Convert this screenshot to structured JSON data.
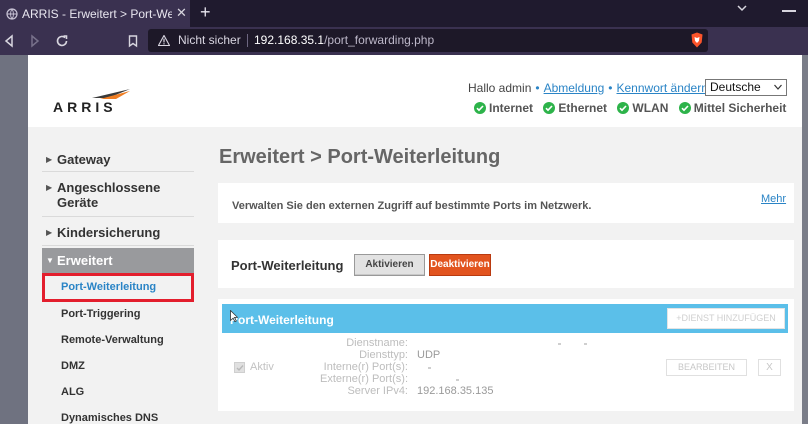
{
  "browser": {
    "tab_title": "ARRIS - Erweitert > Port-Weiterle",
    "new_tab_glyph": "+",
    "close_glyph": "✕",
    "security_label": "Nicht sicher",
    "url_host": "192.168.35.1",
    "url_path": "/port_forwarding.php",
    "icons": [
      "back-icon",
      "forward-icon",
      "reload-icon",
      "bookmark-icon",
      "warning-icon",
      "brave-shield-icon"
    ]
  },
  "header": {
    "logo": "ARRIS",
    "greeting": "Hallo admin",
    "logout": "Abmeldung",
    "change_password": "Kennwort ändern",
    "language": "Deutsche",
    "status": [
      "Internet",
      "Ethernet",
      "WLAN",
      "Mittel Sicherheit"
    ],
    "status_color": "#2db34a"
  },
  "sidebar": {
    "items": [
      "Gateway",
      "Angeschlossene Geräte",
      "Kindersicherung",
      "Erweitert"
    ],
    "item_lines": {
      "angeschlossene_1": "Angeschlossene",
      "angeschlossene_2": "Geräte"
    },
    "submenu": [
      "Port-Weiterleitung",
      "Port-Triggering",
      "Remote-Verwaltung",
      "DMZ",
      "ALG",
      "Dynamisches DNS"
    ]
  },
  "main": {
    "title": "Erweitert > Port-Weiterleitung",
    "info": "Verwalten Sie den externen Zugriff auf bestimmte Ports im Netzwerk.",
    "more": "Mehr",
    "toggle_label": "Port-Weiterleitung",
    "enable_label": "Aktivieren",
    "disable_label": "Deaktivieren",
    "panel_title": "Port-Weiterleitung",
    "add_service": "+DIENST HINZUFÜGEN",
    "entry": {
      "active_label": "Aktiv",
      "service_name_label": "Dienstname:",
      "service_type_label": "Diensttyp:",
      "service_type": "UDP",
      "internal_ports_label": "Interne(r) Port(s):",
      "external_ports_label": "Externe(r) Port(s):",
      "server_label": "Server IPv4:",
      "server_ip": "192.168.35.135",
      "edit": "BEARBEITEN",
      "delete": "X"
    }
  },
  "colors": {
    "accent_blue": "#2a84c6",
    "panel_header": "#5bbfe9",
    "disable_button": "#e2541f",
    "highlight_box": "#e31e2d"
  }
}
